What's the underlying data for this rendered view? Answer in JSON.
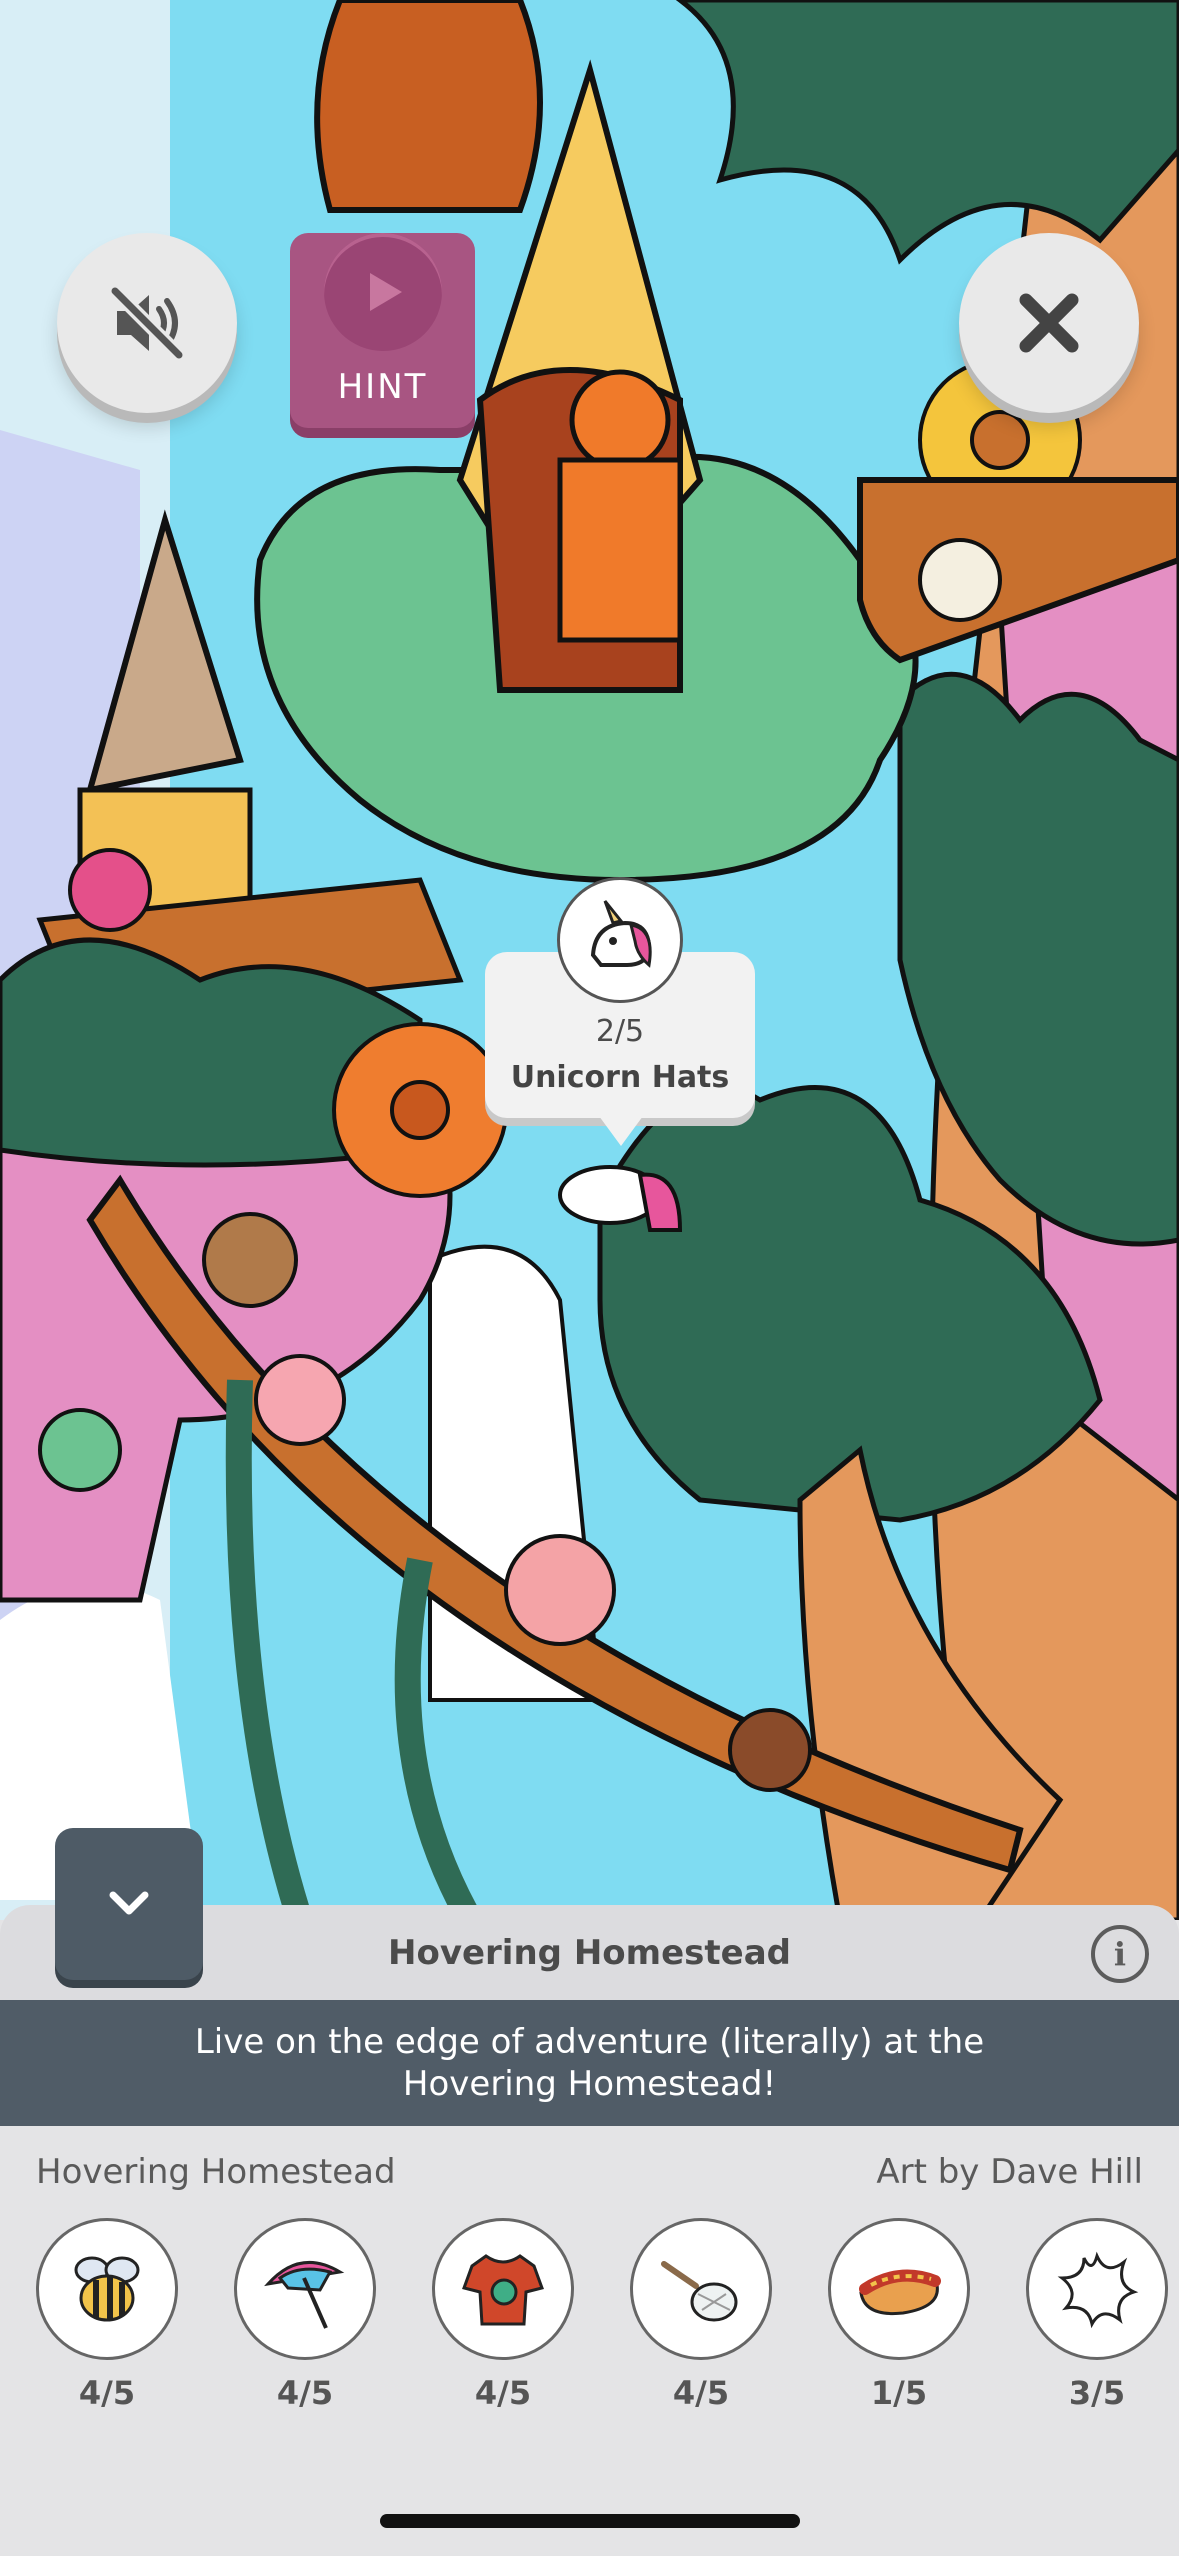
{
  "scene": {
    "description_colors": {
      "sky": "#7fdcf2",
      "foliage": "#2f6b55",
      "wood": "#c8702e"
    }
  },
  "controls": {
    "mute_icon": "speaker-muted-icon",
    "hint_label": "HINT",
    "close_icon": "close-icon",
    "collapse_icon": "chevron-down-icon"
  },
  "callout": {
    "count": "2/5",
    "name": "Unicorn Hats",
    "icon": "unicorn-icon"
  },
  "panel": {
    "title": "Hovering Homestead",
    "info_icon": "info-icon",
    "info_glyph": "i",
    "description": "Live on the edge of adventure (literally) at the Hovering Homestead!",
    "level_name": "Hovering Homestead",
    "credit": "Art by Dave Hill"
  },
  "items": [
    {
      "icon": "bee-icon",
      "score": "4/5"
    },
    {
      "icon": "umbrella-icon",
      "score": "4/5"
    },
    {
      "icon": "shirt-icon",
      "score": "4/5"
    },
    {
      "icon": "net-icon",
      "score": "4/5"
    },
    {
      "icon": "hotdog-icon",
      "score": "1/5"
    },
    {
      "icon": "splat-icon",
      "score": "3/5"
    }
  ]
}
